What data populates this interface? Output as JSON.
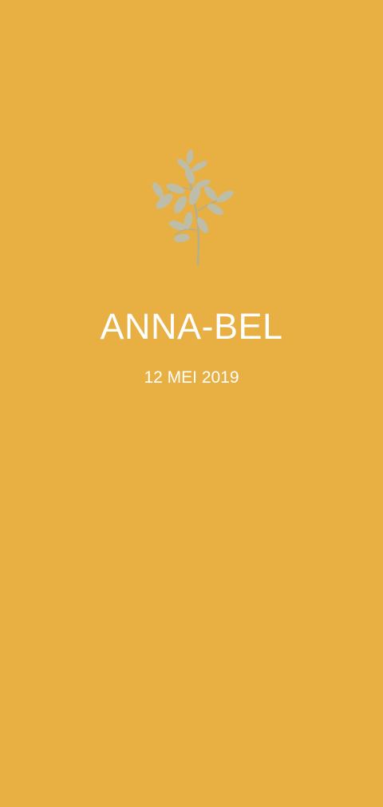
{
  "card": {
    "background_color": "#E8B042",
    "icon": "olive-sprig-icon",
    "icon_color": "#BDBDA8",
    "name": "ANNA-BEL",
    "date": "12 MEI 2019",
    "text_color": "#FFFFFF"
  }
}
